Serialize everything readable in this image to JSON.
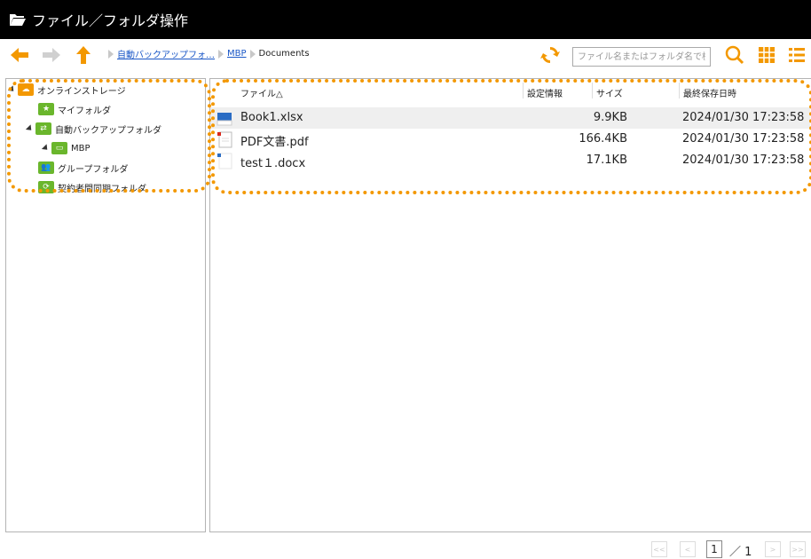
{
  "window": {
    "title": "ファイル／フォルダ操作"
  },
  "breadcrumb": {
    "items": [
      {
        "label": "自動バックアップフォ…",
        "link": true
      },
      {
        "label": "MBP",
        "link": true
      },
      {
        "label": "Documents",
        "link": false
      }
    ]
  },
  "search": {
    "placeholder": "ファイル名またはフォルダ名で検索"
  },
  "tree": {
    "root": "オンラインストレージ",
    "my_folder": "マイフォルダ",
    "auto_backup": "自動バックアップフォルダ",
    "mbp": "MBP",
    "group_folder": "グループフォルダ",
    "contract_sync": "契約者間同期フォルダ"
  },
  "table": {
    "headers": {
      "name": "ファイル△",
      "settings": "設定情報",
      "size": "サイズ",
      "modified": "最終保存日時"
    },
    "rows": [
      {
        "name": "Book1.xlsx",
        "size": "9.9KB",
        "modified": "2024/01/30 17:23:58",
        "type": "excel"
      },
      {
        "name": "PDF文書.pdf",
        "size": "166.4KB",
        "modified": "2024/01/30 17:23:58",
        "type": "pdf"
      },
      {
        "name": "test１.docx",
        "size": "17.1KB",
        "modified": "2024/01/30 17:23:58",
        "type": "word"
      }
    ]
  },
  "pager": {
    "first": "<<",
    "prev": "<",
    "current": "1",
    "total": "／ 1",
    "next": ">",
    "last": ">>"
  },
  "colors": {
    "accent": "#f39800",
    "folder_green": "#6ab62c",
    "title_bg": "#000000",
    "link": "#1a57c7"
  }
}
